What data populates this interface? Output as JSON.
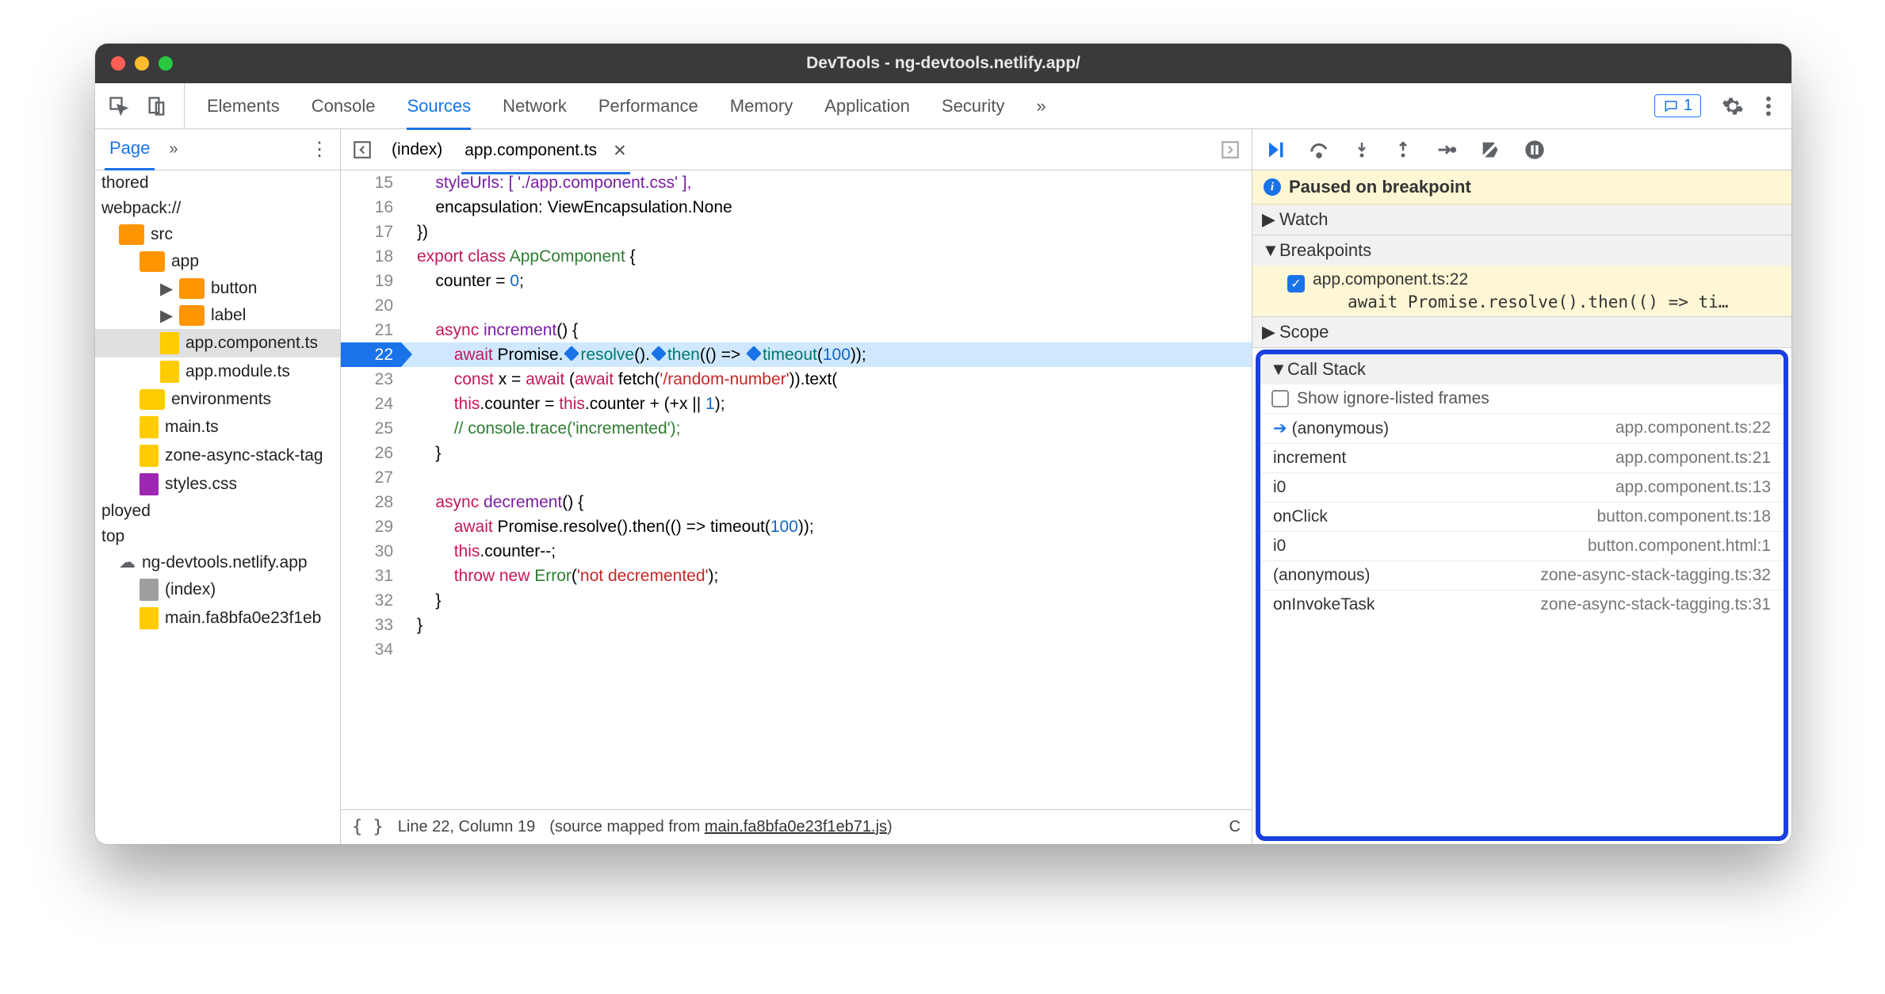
{
  "window": {
    "title": "DevTools - ng-devtools.netlify.app/"
  },
  "tabs": {
    "items": [
      "Elements",
      "Console",
      "Sources",
      "Network",
      "Performance",
      "Memory",
      "Application",
      "Security"
    ],
    "active": "Sources",
    "overflow": "»",
    "messageCount": "1"
  },
  "leftPane": {
    "tab": "Page",
    "overflow": "»",
    "nodes": {
      "thored": "thored",
      "webpack": "webpack://",
      "src": "src",
      "app": "app",
      "button": "button",
      "label": "label",
      "appComponentTs": "app.component.ts",
      "appModuleTs": "app.module.ts",
      "environments": "environments",
      "mainTs": "main.ts",
      "zoneAsync": "zone-async-stack-tag",
      "stylesCss": "styles.css",
      "ployed": "ployed",
      "top": "top",
      "cloud": "ng-devtools.netlify.app",
      "indexFile": "(index)",
      "mainChunk": "main.fa8bfa0e23f1eb"
    }
  },
  "editor": {
    "tabs": {
      "index": "(index)",
      "active": "app.component.ts"
    },
    "startLine": 15,
    "lines": {
      "l15": "    styleUrls: [ './app.component.css' ],",
      "l16": "    encapsulation: ViewEncapsulation.None",
      "l17": "})",
      "l18_export": "export ",
      "l18_class": "class ",
      "l18_name": "AppComponent",
      "l18_brace": " {",
      "l19_a": "    counter = ",
      "l19_b": "0",
      "l19_c": ";",
      "l20": " ",
      "l21_a": "    ",
      "l21_b": "async ",
      "l21_c": "increment",
      "l21_d": "() {",
      "l22_a": "        ",
      "l22_b": "await ",
      "l22_c": "Promise.",
      "l22_d": "resolve",
      "l22_e": "().",
      "l22_f": "then",
      "l22_g": "(() => ",
      "l22_h": "timeout",
      "l22_i": "(",
      "l22_j": "100",
      "l22_k": "));",
      "l23_a": "        ",
      "l23_b": "const ",
      "l23_c": "x = ",
      "l23_d": "await ",
      "l23_e": "(",
      "l23_f": "await ",
      "l23_g": "fetch(",
      "l23_h": "'/random-number'",
      "l23_i": ")).text(",
      "l24_a": "        ",
      "l24_b": "this",
      "l24_c": ".counter = ",
      "l24_d": "this",
      "l24_e": ".counter + (+x || ",
      "l24_f": "1",
      "l24_g": ");",
      "l25_a": "        ",
      "l25_b": "// console.trace('incremented');",
      "l26": "    }",
      "l27": " ",
      "l28_a": "    ",
      "l28_b": "async ",
      "l28_c": "decrement",
      "l28_d": "() {",
      "l29_a": "        ",
      "l29_b": "await ",
      "l29_c": "Promise.resolve().then(() => timeout(",
      "l29_d": "100",
      "l29_e": "));",
      "l30_a": "        ",
      "l30_b": "this",
      "l30_c": ".counter--;",
      "l31_a": "        ",
      "l31_b": "throw new ",
      "l31_c": "Error",
      "l31_d": "(",
      "l31_e": "'not decremented'",
      "l31_f": ");",
      "l32": "    }",
      "l33": "}",
      "l34": " "
    },
    "footer": {
      "position": "Line 22, Column 19",
      "mapPrefix": "(source mapped from ",
      "mapFile": "main.fa8bfa0e23f1eb71.js",
      "mapSuffix": ")",
      "coverage": "C"
    }
  },
  "debugger": {
    "pausedBanner": "Paused on breakpoint",
    "watch": "Watch",
    "breakpoints": {
      "title": "Breakpoints",
      "item": {
        "file": "app.component.ts:22",
        "code": "await Promise.resolve().then(() => ti…"
      }
    },
    "scope": "Scope",
    "callStack": {
      "title": "Call Stack",
      "showIgnored": "Show ignore-listed frames",
      "frames": [
        {
          "name": "(anonymous)",
          "loc": "app.component.ts:22"
        },
        {
          "name": "increment",
          "loc": "app.component.ts:21"
        },
        {
          "name": "i0",
          "loc": "app.component.ts:13"
        },
        {
          "name": "onClick",
          "loc": "button.component.ts:18"
        },
        {
          "name": "i0",
          "loc": "button.component.html:1"
        },
        {
          "name": "(anonymous)",
          "loc": "zone-async-stack-tagging.ts:32"
        },
        {
          "name": "onInvokeTask",
          "loc": "zone-async-stack-tagging.ts:31"
        }
      ]
    }
  },
  "lineNumbers": {
    "n15": "15",
    "n16": "16",
    "n17": "17",
    "n18": "18",
    "n19": "19",
    "n20": "20",
    "n21": "21",
    "n22": "22",
    "n23": "23",
    "n24": "24",
    "n25": "25",
    "n26": "26",
    "n27": "27",
    "n28": "28",
    "n29": "29",
    "n30": "30",
    "n31": "31",
    "n32": "32",
    "n33": "33",
    "n34": "34"
  }
}
